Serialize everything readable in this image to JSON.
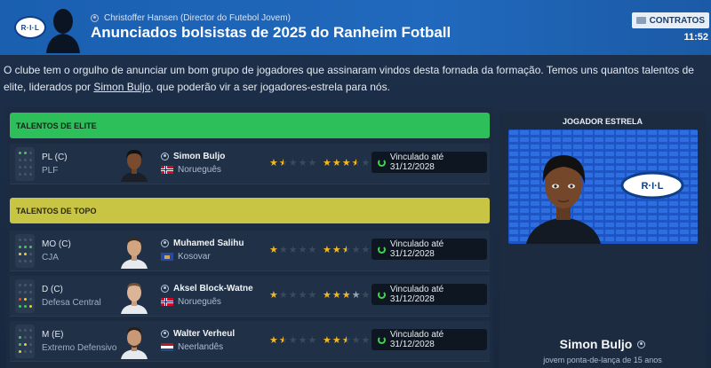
{
  "header": {
    "club_logo_text": "R·I·L",
    "sender": "Christoffer Hansen  (Director do Futebol Jovem)",
    "title": "Anunciados bolsistas de 2025 do Ranheim Fotball",
    "contracts_label": "CONTRATOS",
    "time": "11:52"
  },
  "intro": {
    "text_before": "O clube tem o orgulho de anunciar um bom grupo de jogadores que assinaram vindos desta fornada da formação. Temos uns quantos talentos de elite, liderados por ",
    "link": "Simon Buljo",
    "text_after": ", que poderão vir a ser jogadores-estrela para nós."
  },
  "sections": {
    "elite": "TALENTOS DE ELITE",
    "top": "TALENTOS DE TOPO"
  },
  "players": [
    {
      "position": "PL (C)",
      "role": "PLF",
      "name": "Simon Buljo",
      "nationality": "Norueguês",
      "current_ability_stars": 1.5,
      "potential_ability_stars": 3.5,
      "contract": "Vinculado até 31/12/2028"
    },
    {
      "position": "MO (C)",
      "role": "CJA",
      "name": "Muhamed Salihu",
      "nationality": "Kosovar",
      "current_ability_stars": 1,
      "potential_ability_stars": 2.5,
      "contract": "Vinculado até 31/12/2028"
    },
    {
      "position": "D (C)",
      "role": "Defesa Central",
      "name": "Aksel Block-Watne",
      "nationality": "Norueguês",
      "current_ability_stars": 1,
      "potential_ability_stars": 3,
      "contract": "Vinculado até 31/12/2028"
    },
    {
      "position": "M (E)",
      "role": "Extremo Defensivo",
      "name": "Walter Verheul",
      "nationality": "Neerlandês",
      "current_ability_stars": 1.5,
      "potential_ability_stars": 2.5,
      "contract": "Vinculado até 31/12/2028"
    }
  ],
  "star_player": {
    "heading": "JOGADOR ESTRELA",
    "badge_text": "R·I·L",
    "name": "Simon Buljo",
    "description": "jovem ponta-de-lança de 15 anos"
  },
  "colors": {
    "header_blue": "#1f64b8",
    "elite_green": "#2dbf59",
    "top_yellow": "#c9c544",
    "star_gold": "#f5b71f"
  }
}
